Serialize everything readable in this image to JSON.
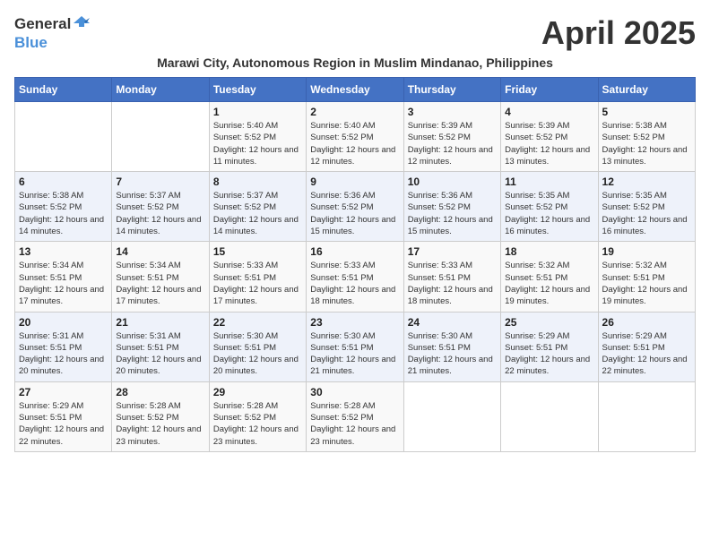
{
  "header": {
    "logo_general": "General",
    "logo_blue": "Blue",
    "title": "April 2025",
    "subtitle": "Marawi City, Autonomous Region in Muslim Mindanao, Philippines"
  },
  "days_of_week": [
    "Sunday",
    "Monday",
    "Tuesday",
    "Wednesday",
    "Thursday",
    "Friday",
    "Saturday"
  ],
  "weeks": [
    [
      {
        "day": "",
        "info": ""
      },
      {
        "day": "",
        "info": ""
      },
      {
        "day": "1",
        "info": "Sunrise: 5:40 AM\nSunset: 5:52 PM\nDaylight: 12 hours and 11 minutes."
      },
      {
        "day": "2",
        "info": "Sunrise: 5:40 AM\nSunset: 5:52 PM\nDaylight: 12 hours and 12 minutes."
      },
      {
        "day": "3",
        "info": "Sunrise: 5:39 AM\nSunset: 5:52 PM\nDaylight: 12 hours and 12 minutes."
      },
      {
        "day": "4",
        "info": "Sunrise: 5:39 AM\nSunset: 5:52 PM\nDaylight: 12 hours and 13 minutes."
      },
      {
        "day": "5",
        "info": "Sunrise: 5:38 AM\nSunset: 5:52 PM\nDaylight: 12 hours and 13 minutes."
      }
    ],
    [
      {
        "day": "6",
        "info": "Sunrise: 5:38 AM\nSunset: 5:52 PM\nDaylight: 12 hours and 14 minutes."
      },
      {
        "day": "7",
        "info": "Sunrise: 5:37 AM\nSunset: 5:52 PM\nDaylight: 12 hours and 14 minutes."
      },
      {
        "day": "8",
        "info": "Sunrise: 5:37 AM\nSunset: 5:52 PM\nDaylight: 12 hours and 14 minutes."
      },
      {
        "day": "9",
        "info": "Sunrise: 5:36 AM\nSunset: 5:52 PM\nDaylight: 12 hours and 15 minutes."
      },
      {
        "day": "10",
        "info": "Sunrise: 5:36 AM\nSunset: 5:52 PM\nDaylight: 12 hours and 15 minutes."
      },
      {
        "day": "11",
        "info": "Sunrise: 5:35 AM\nSunset: 5:52 PM\nDaylight: 12 hours and 16 minutes."
      },
      {
        "day": "12",
        "info": "Sunrise: 5:35 AM\nSunset: 5:52 PM\nDaylight: 12 hours and 16 minutes."
      }
    ],
    [
      {
        "day": "13",
        "info": "Sunrise: 5:34 AM\nSunset: 5:51 PM\nDaylight: 12 hours and 17 minutes."
      },
      {
        "day": "14",
        "info": "Sunrise: 5:34 AM\nSunset: 5:51 PM\nDaylight: 12 hours and 17 minutes."
      },
      {
        "day": "15",
        "info": "Sunrise: 5:33 AM\nSunset: 5:51 PM\nDaylight: 12 hours and 17 minutes."
      },
      {
        "day": "16",
        "info": "Sunrise: 5:33 AM\nSunset: 5:51 PM\nDaylight: 12 hours and 18 minutes."
      },
      {
        "day": "17",
        "info": "Sunrise: 5:33 AM\nSunset: 5:51 PM\nDaylight: 12 hours and 18 minutes."
      },
      {
        "day": "18",
        "info": "Sunrise: 5:32 AM\nSunset: 5:51 PM\nDaylight: 12 hours and 19 minutes."
      },
      {
        "day": "19",
        "info": "Sunrise: 5:32 AM\nSunset: 5:51 PM\nDaylight: 12 hours and 19 minutes."
      }
    ],
    [
      {
        "day": "20",
        "info": "Sunrise: 5:31 AM\nSunset: 5:51 PM\nDaylight: 12 hours and 20 minutes."
      },
      {
        "day": "21",
        "info": "Sunrise: 5:31 AM\nSunset: 5:51 PM\nDaylight: 12 hours and 20 minutes."
      },
      {
        "day": "22",
        "info": "Sunrise: 5:30 AM\nSunset: 5:51 PM\nDaylight: 12 hours and 20 minutes."
      },
      {
        "day": "23",
        "info": "Sunrise: 5:30 AM\nSunset: 5:51 PM\nDaylight: 12 hours and 21 minutes."
      },
      {
        "day": "24",
        "info": "Sunrise: 5:30 AM\nSunset: 5:51 PM\nDaylight: 12 hours and 21 minutes."
      },
      {
        "day": "25",
        "info": "Sunrise: 5:29 AM\nSunset: 5:51 PM\nDaylight: 12 hours and 22 minutes."
      },
      {
        "day": "26",
        "info": "Sunrise: 5:29 AM\nSunset: 5:51 PM\nDaylight: 12 hours and 22 minutes."
      }
    ],
    [
      {
        "day": "27",
        "info": "Sunrise: 5:29 AM\nSunset: 5:51 PM\nDaylight: 12 hours and 22 minutes."
      },
      {
        "day": "28",
        "info": "Sunrise: 5:28 AM\nSunset: 5:52 PM\nDaylight: 12 hours and 23 minutes."
      },
      {
        "day": "29",
        "info": "Sunrise: 5:28 AM\nSunset: 5:52 PM\nDaylight: 12 hours and 23 minutes."
      },
      {
        "day": "30",
        "info": "Sunrise: 5:28 AM\nSunset: 5:52 PM\nDaylight: 12 hours and 23 minutes."
      },
      {
        "day": "",
        "info": ""
      },
      {
        "day": "",
        "info": ""
      },
      {
        "day": "",
        "info": ""
      }
    ]
  ]
}
